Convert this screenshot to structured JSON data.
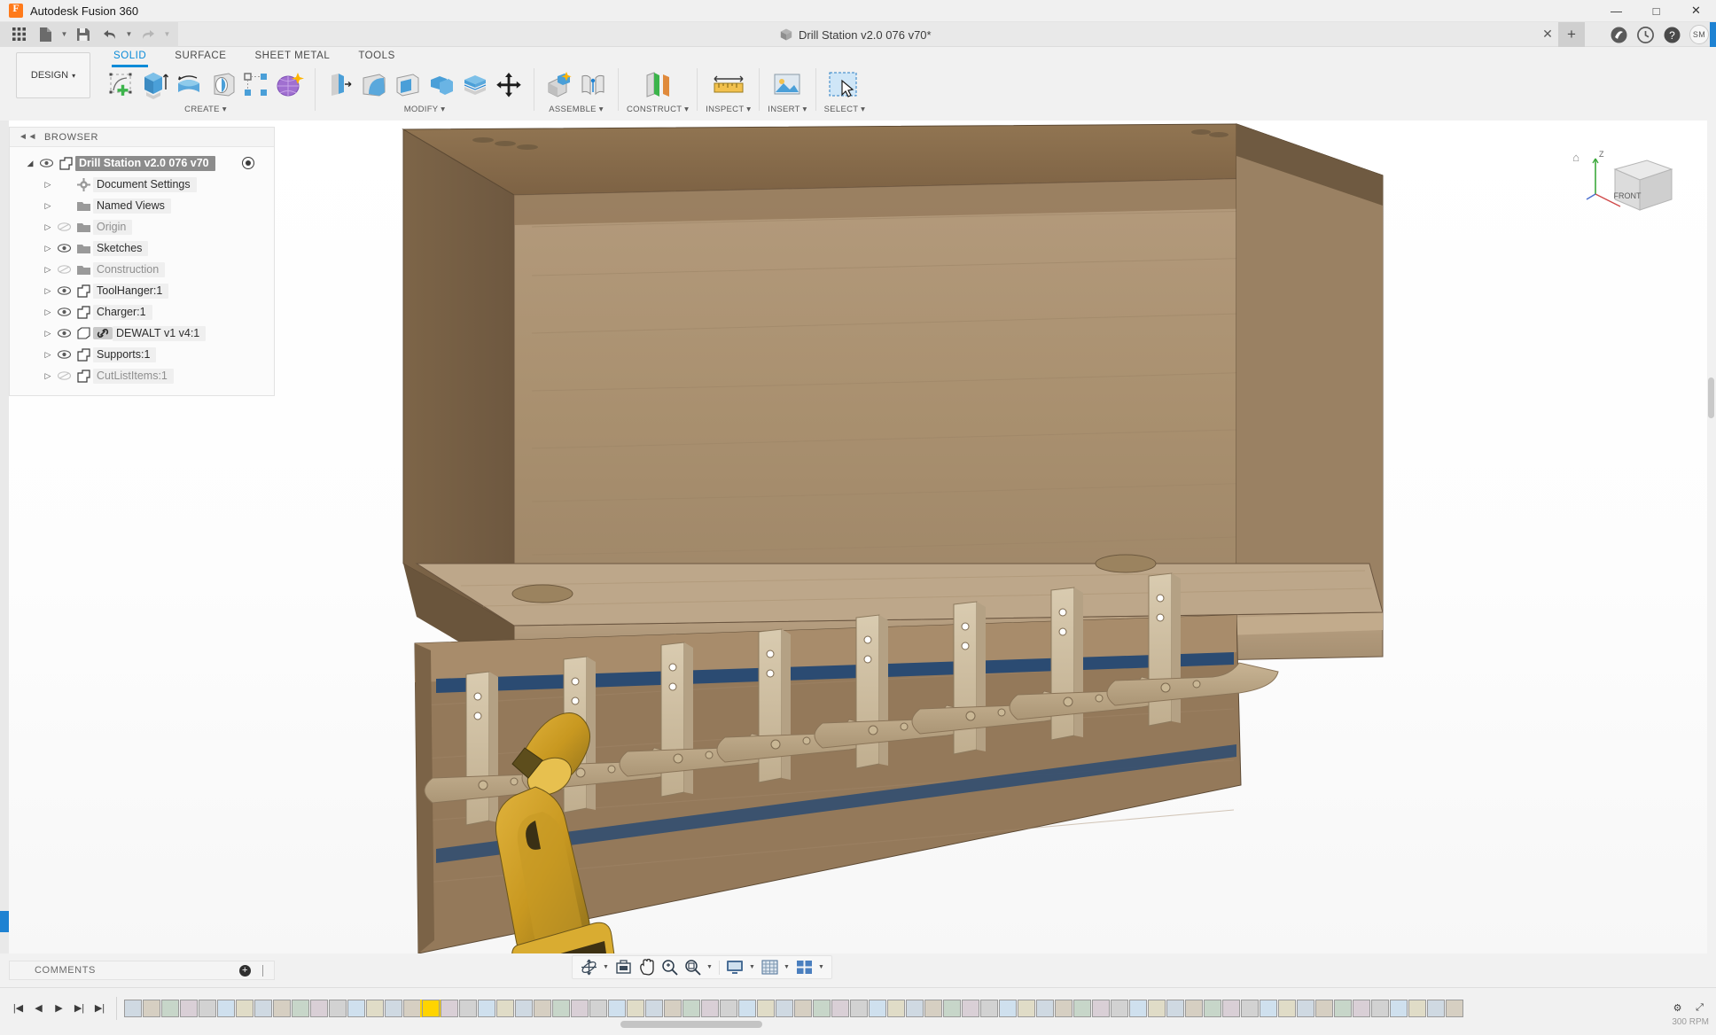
{
  "window": {
    "app_title": "Autodesk Fusion 360",
    "logo_letter": "F",
    "minimize": "—",
    "maximize": "□",
    "close": "✕"
  },
  "quick_access": {
    "buttons": [
      {
        "name": "app-grid-icon",
        "glyph": "▦"
      },
      {
        "name": "new-file-icon",
        "glyph": "🗎"
      },
      {
        "name": "save-icon",
        "glyph": "💾"
      },
      {
        "name": "undo-icon",
        "glyph": "↶"
      },
      {
        "name": "redo-icon",
        "glyph": "↷"
      }
    ],
    "document_tab": "Drill Station v2.0 076 v70*",
    "tab_close": "✕",
    "new_tab": "+",
    "right_icons": [
      {
        "name": "extensions-icon",
        "glyph": "◕"
      },
      {
        "name": "job-status-icon",
        "glyph": "🕐"
      },
      {
        "name": "help-icon",
        "glyph": "?"
      }
    ],
    "avatar_initials": "SM"
  },
  "ribbon": {
    "workspace_label": "DESIGN",
    "workspace_caret": "▾",
    "tabs": [
      {
        "label": "SOLID",
        "active": true
      },
      {
        "label": "SURFACE",
        "active": false
      },
      {
        "label": "SHEET METAL",
        "active": false
      },
      {
        "label": "TOOLS",
        "active": false
      }
    ],
    "groups": [
      {
        "label": "CREATE ▾",
        "name": "create-group",
        "icons": [
          "create-sketch-icon",
          "extrude-icon",
          "revolve-icon",
          "sweep-icon",
          "pattern-icon",
          "form-icon"
        ]
      },
      {
        "label": "MODIFY ▾",
        "name": "modify-group",
        "icons": [
          "press-pull-icon",
          "fillet-icon",
          "shell-icon",
          "combine-icon",
          "offset-face-icon",
          "move-copy-icon"
        ]
      },
      {
        "label": "ASSEMBLE ▾",
        "name": "assemble-group",
        "icons": [
          "new-component-icon",
          "joint-icon"
        ]
      },
      {
        "label": "CONSTRUCT ▾",
        "name": "construct-group",
        "icons": [
          "offset-plane-icon"
        ]
      },
      {
        "label": "INSPECT ▾",
        "name": "inspect-group",
        "icons": [
          "measure-icon"
        ]
      },
      {
        "label": "INSERT ▾",
        "name": "insert-group",
        "icons": [
          "insert-mcmaster-icon"
        ]
      },
      {
        "label": "SELECT ▾",
        "name": "select-group",
        "icons": [
          "select-window-icon"
        ]
      }
    ]
  },
  "browser": {
    "title": "BROWSER",
    "collapse_glyph": "◄◄",
    "items": [
      {
        "label": "Drill Station v2.0 076 v70",
        "icon": "component-icon",
        "root": true,
        "visible": true,
        "indent": 0
      },
      {
        "label": "Document Settings",
        "icon": "gear-icon",
        "root": false,
        "visible": true,
        "indent": 1,
        "eye": false
      },
      {
        "label": "Named Views",
        "icon": "folder-icon",
        "root": false,
        "visible": true,
        "indent": 1,
        "eye": false
      },
      {
        "label": "Origin",
        "icon": "folder-icon",
        "root": false,
        "visible": false,
        "indent": 1,
        "eye": true
      },
      {
        "label": "Sketches",
        "icon": "folder-icon",
        "root": false,
        "visible": true,
        "indent": 1,
        "eye": true
      },
      {
        "label": "Construction",
        "icon": "folder-icon",
        "root": false,
        "visible": false,
        "indent": 1,
        "eye": true
      },
      {
        "label": "ToolHanger:1",
        "icon": "component-icon",
        "root": false,
        "visible": true,
        "indent": 1,
        "eye": true
      },
      {
        "label": "Charger:1",
        "icon": "component-icon",
        "root": false,
        "visible": true,
        "indent": 1,
        "eye": true
      },
      {
        "label": "DEWALT v1 v4:1",
        "icon": "linked-component-icon",
        "root": false,
        "visible": true,
        "indent": 1,
        "eye": true,
        "linked": true
      },
      {
        "label": "Supports:1",
        "icon": "component-icon",
        "root": false,
        "visible": true,
        "indent": 1,
        "eye": true
      },
      {
        "label": "CutListItems:1",
        "icon": "component-icon",
        "root": false,
        "visible": false,
        "indent": 1,
        "eye": true
      }
    ]
  },
  "viewcube": {
    "front_label": "FRONT",
    "axis_z": "Z",
    "home_glyph": "⌂"
  },
  "comments": {
    "title": "COMMENTS",
    "add_glyph": "+"
  },
  "nav_bar": {
    "items": [
      {
        "name": "orbit-icon",
        "glyph": "orbit",
        "caret": true
      },
      {
        "name": "look-at-icon",
        "glyph": "lookat",
        "caret": false
      },
      {
        "name": "pan-icon",
        "glyph": "pan",
        "caret": false
      },
      {
        "name": "zoom-icon",
        "glyph": "zoom",
        "caret": false
      },
      {
        "name": "fit-icon",
        "glyph": "fit",
        "caret": true
      },
      {
        "name": "display-settings-icon",
        "glyph": "display",
        "caret": true
      },
      {
        "name": "grid-snap-icon",
        "glyph": "grid",
        "caret": true
      },
      {
        "name": "viewports-icon",
        "glyph": "viewports",
        "caret": true
      }
    ]
  },
  "timeline": {
    "playback": [
      {
        "name": "timeline-begin-button",
        "glyph": "|◀"
      },
      {
        "name": "timeline-step-back-button",
        "glyph": "◀"
      },
      {
        "name": "timeline-play-button",
        "glyph": "▶"
      },
      {
        "name": "timeline-step-forward-button",
        "glyph": "▶|"
      },
      {
        "name": "timeline-end-button",
        "glyph": "▶|"
      }
    ],
    "feature_count": 72,
    "selected_index": 16,
    "end_controls": [
      {
        "name": "timeline-settings-icon",
        "glyph": "⚙"
      },
      {
        "name": "timeline-expand-icon",
        "glyph": "⤢"
      }
    ],
    "status_number": "300 RPM"
  },
  "model": {
    "description": "3D shaded wood drill station cabinet with hanging drill holders and a yellow cordless drill",
    "colors": {
      "wood_dark": "#8a6f52",
      "wood_mid": "#a2866a",
      "wood_light": "#c4ad90",
      "wood_pale": "#d6c7ae",
      "accent_blue": "#2b4b72",
      "drill_yellow": "#d4a32a",
      "drill_dark": "#6d5a26"
    }
  }
}
